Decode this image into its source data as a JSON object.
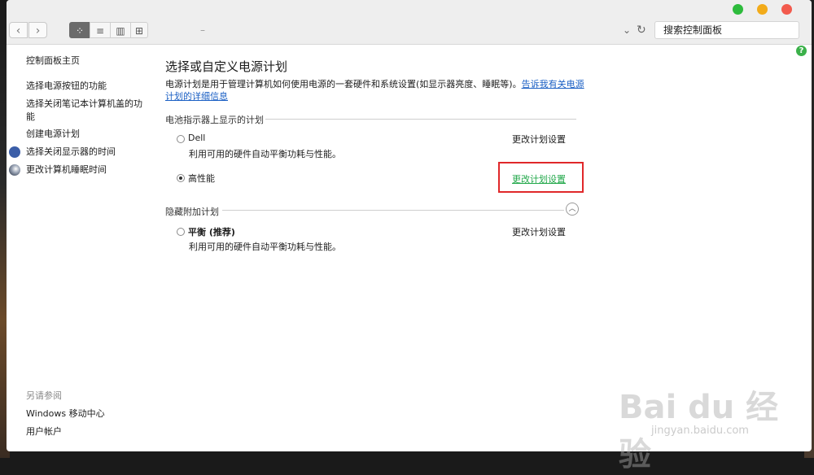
{
  "window": {
    "search_placeholder": "搜索控制面板",
    "help_glyph": "?"
  },
  "left_pane": {
    "home": "控制面板主页",
    "tasks": [
      "选择电源按钮的功能",
      "选择关闭笔记本计算机盖的功",
      "能",
      "创建电源计划",
      "选择关闭显示器的时间",
      "更改计算机睡眠时间"
    ],
    "see_also_title": "另请参阅",
    "see_also": [
      "Windows 移动中心",
      "用户帐户"
    ]
  },
  "main": {
    "title": "选择或自定义电源计划",
    "description": "电源计划是用于管理计算机如何使用电源的一套硬件和系统设置(如显示器亮度、睡眠等)。",
    "description_link": "告诉我有关电源计划的详细信息",
    "battery_section": "电池指示器上显示的计划",
    "hidden_section": "隐藏附加计划",
    "plans": [
      {
        "name": "Dell",
        "description": "利用可用的硬件自动平衡功耗与性能。",
        "link": "更改计划设置",
        "selected": false
      },
      {
        "name": "高性能",
        "description": "",
        "link": "更改计划设置",
        "selected": true
      },
      {
        "name": "平衡 (推荐)",
        "description": "利用可用的硬件自动平衡功耗与性能。",
        "link": "更改计划设置",
        "selected": false
      }
    ]
  },
  "watermark": {
    "brand": "Bai du 经验",
    "url": "jingyan.baidu.com"
  },
  "colors": {
    "link_blue": "#1a5fc4",
    "highlight_green": "#22a84a",
    "annotation_red": "#e0282a"
  }
}
